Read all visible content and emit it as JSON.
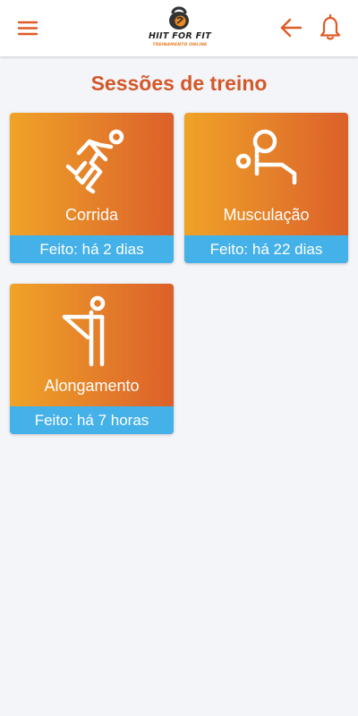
{
  "app": {
    "logo_title": "HIIT FOR FIT",
    "logo_subtitle": "TREINAMENTO ONLINE"
  },
  "header": {
    "menu_icon": "hamburger-menu-icon",
    "back_icon": "arrow-left-icon",
    "notification_icon": "bell-icon"
  },
  "colors": {
    "accent": "#e05a26",
    "card_gradient_start": "#f0a327",
    "card_gradient_end": "#dc6029",
    "status_bar": "#45b1e9",
    "background": "#f4f5f9"
  },
  "page": {
    "title": "Sessões de treino"
  },
  "sessions": [
    {
      "label": "Corrida",
      "status": "Feito: há 2 dias",
      "icon": "running-icon"
    },
    {
      "label": "Musculação",
      "status": "Feito: há 22 dias",
      "icon": "weight-bench-icon"
    },
    {
      "label": "Alongamento",
      "status": "Feito: há 7 horas",
      "icon": "stretching-icon"
    }
  ]
}
